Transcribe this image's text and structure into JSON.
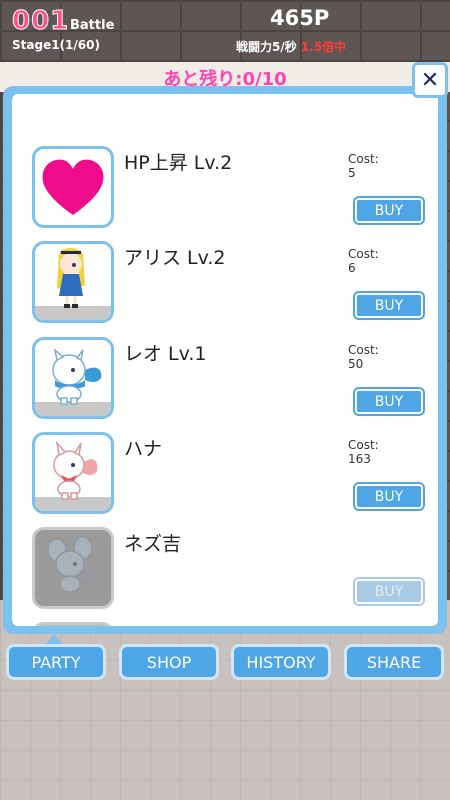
{
  "hud": {
    "stage_num": "001",
    "mode": "Battle",
    "stage": "Stage1(1/60)",
    "points": "465P",
    "dps_text": "戦闘力5/秒",
    "multiplier": "1.5倍中"
  },
  "remaining": "あと残り:0/10",
  "close_label": "✕",
  "shop": {
    "cost_label": "Cost:",
    "items": [
      {
        "name": "HP上昇 Lv.2",
        "cost": "5",
        "buy": "BUY",
        "icon": "heart-icon",
        "enabled": true
      },
      {
        "name": "アリス Lv.2",
        "cost": "6",
        "buy": "BUY",
        "icon": "alice-character-icon",
        "enabled": true
      },
      {
        "name": "レオ Lv.1",
        "cost": "50",
        "buy": "BUY",
        "icon": "leo-character-icon",
        "enabled": true
      },
      {
        "name": "ハナ",
        "cost": "163",
        "buy": "BUY",
        "icon": "hana-character-icon",
        "enabled": true
      },
      {
        "name": "ネズ吉",
        "cost": "",
        "buy": "BUY",
        "icon": "nezukichi-character-icon",
        "enabled": false
      },
      {
        "name": "????",
        "cost": "",
        "buy": "",
        "icon": "unknown-character-icon",
        "enabled": false
      }
    ]
  },
  "tabs": [
    {
      "label": "PARTY"
    },
    {
      "label": "SHOP"
    },
    {
      "label": "HISTORY"
    },
    {
      "label": "SHARE"
    }
  ],
  "colors": {
    "accent": "#4ea6e6",
    "panel": "#7cc0ee",
    "heart": "#ee0c8a",
    "remaining": "#ff44b0",
    "multiplier": "#ff3b3b"
  }
}
